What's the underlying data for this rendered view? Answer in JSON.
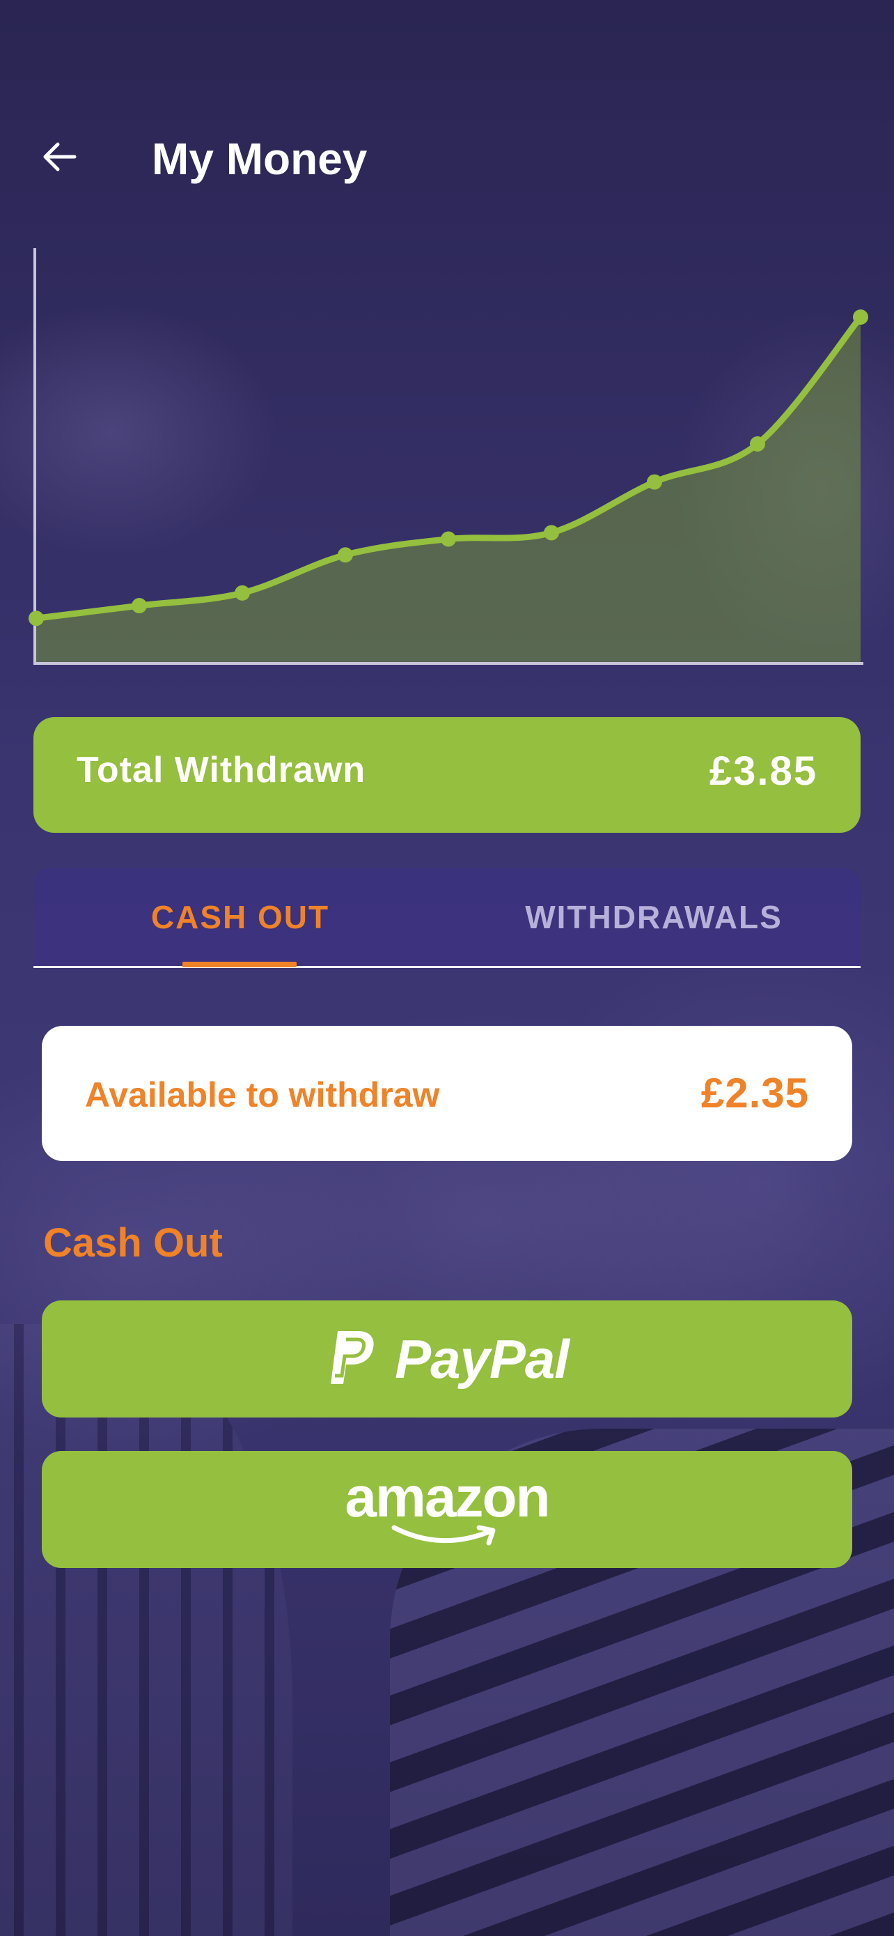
{
  "header": {
    "title": "My Money"
  },
  "total": {
    "label": "Total Withdrawn",
    "value": "£3.85"
  },
  "tabs": [
    {
      "label": "CASH OUT",
      "active": true
    },
    {
      "label": "WITHDRAWALS",
      "active": false
    }
  ],
  "available": {
    "label": "Available to withdraw",
    "value": "£2.35"
  },
  "cashout": {
    "title": "Cash Out",
    "options": [
      {
        "label": "PayPal",
        "icon": "paypal-logo"
      },
      {
        "label": "amazon",
        "icon": "amazon-logo"
      }
    ]
  },
  "colors": {
    "accent_green": "#95bf3e",
    "accent_orange": "#f08228",
    "background": "#2f2a5a",
    "tab_inactive": "#b7b1d9"
  },
  "chart_data": {
    "type": "area",
    "x": [
      1,
      2,
      3,
      4,
      5,
      6,
      7,
      8,
      9
    ],
    "values": [
      0.05,
      0.09,
      0.13,
      0.25,
      0.3,
      0.32,
      0.48,
      0.6,
      1.0
    ],
    "grid": false,
    "title": "",
    "xlabel": "",
    "ylabel": ""
  }
}
